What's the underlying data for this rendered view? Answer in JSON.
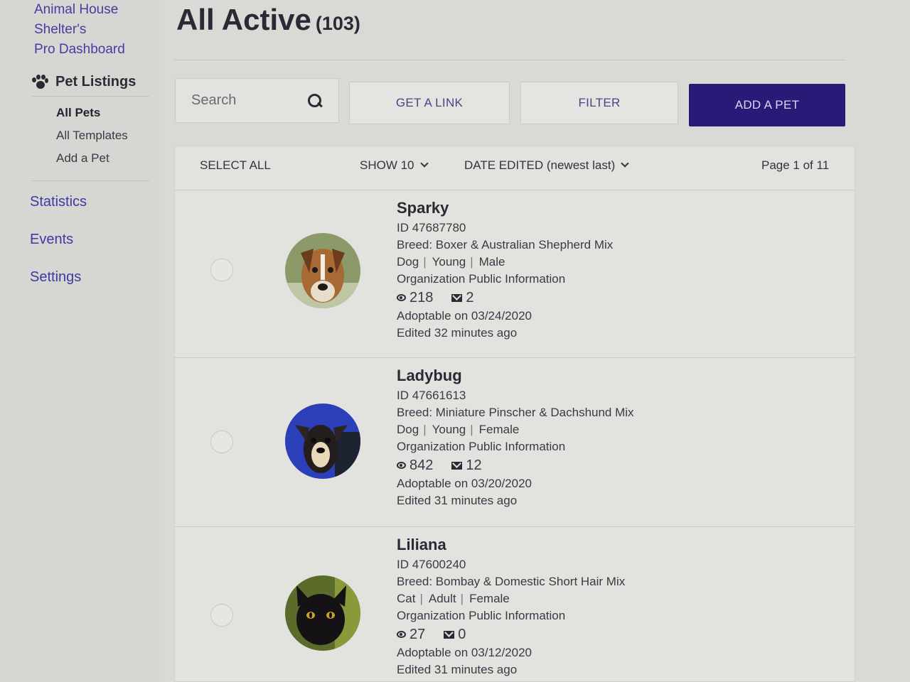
{
  "sidebar": {
    "org_lines": [
      "Animal House",
      "Shelter's",
      "Pro Dashboard"
    ],
    "section": {
      "icon": "paw-icon",
      "label": "Pet Listings",
      "items": [
        {
          "label": "All Pets",
          "active": true
        },
        {
          "label": "All Templates",
          "active": false
        },
        {
          "label": "Add a Pet",
          "active": false
        }
      ]
    },
    "nav": [
      {
        "label": "Statistics"
      },
      {
        "label": "Events"
      },
      {
        "label": "Settings"
      }
    ]
  },
  "header": {
    "title": "All Active",
    "count": "(103)"
  },
  "toolbar": {
    "search_placeholder": "Search",
    "search_icon": "search-icon",
    "get_link_label": "GET A LINK",
    "filter_label": "FILTER",
    "add_pet_label": "ADD A PET"
  },
  "list_controls": {
    "select_all": "SELECT ALL",
    "show": "SHOW 10",
    "sort": "DATE EDITED (newest last)",
    "page": "Page 1 of 11"
  },
  "pets": [
    {
      "name": "Sparky",
      "id": "ID 47687780",
      "breed": "Breed: Boxer & Australian Shepherd Mix",
      "species": "Dog",
      "age": "Young",
      "sex": "Male",
      "org_info": "Organization Public Information",
      "views": "218",
      "messages": "2",
      "adoptable": "Adoptable on 03/24/2020",
      "edited": "Edited 32 minutes ago"
    },
    {
      "name": "Ladybug",
      "id": "ID 47661613",
      "breed": "Breed: Miniature Pinscher & Dachshund Mix",
      "species": "Dog",
      "age": "Young",
      "sex": "Female",
      "org_info": "Organization Public Information",
      "views": "842",
      "messages": "12",
      "adoptable": "Adoptable on 03/20/2020",
      "edited": "Edited 31 minutes ago"
    },
    {
      "name": "Liliana",
      "id": "ID 47600240",
      "breed": "Breed: Bombay & Domestic Short Hair Mix",
      "species": "Cat",
      "age": "Adult",
      "sex": "Female",
      "org_info": "Organization Public Information",
      "views": "27",
      "messages": "0",
      "adoptable": "Adoptable on 03/12/2020",
      "edited": "Edited 31 minutes ago"
    }
  ],
  "colors": {
    "accent": "#2a1a78",
    "link": "#3f3aa2"
  }
}
